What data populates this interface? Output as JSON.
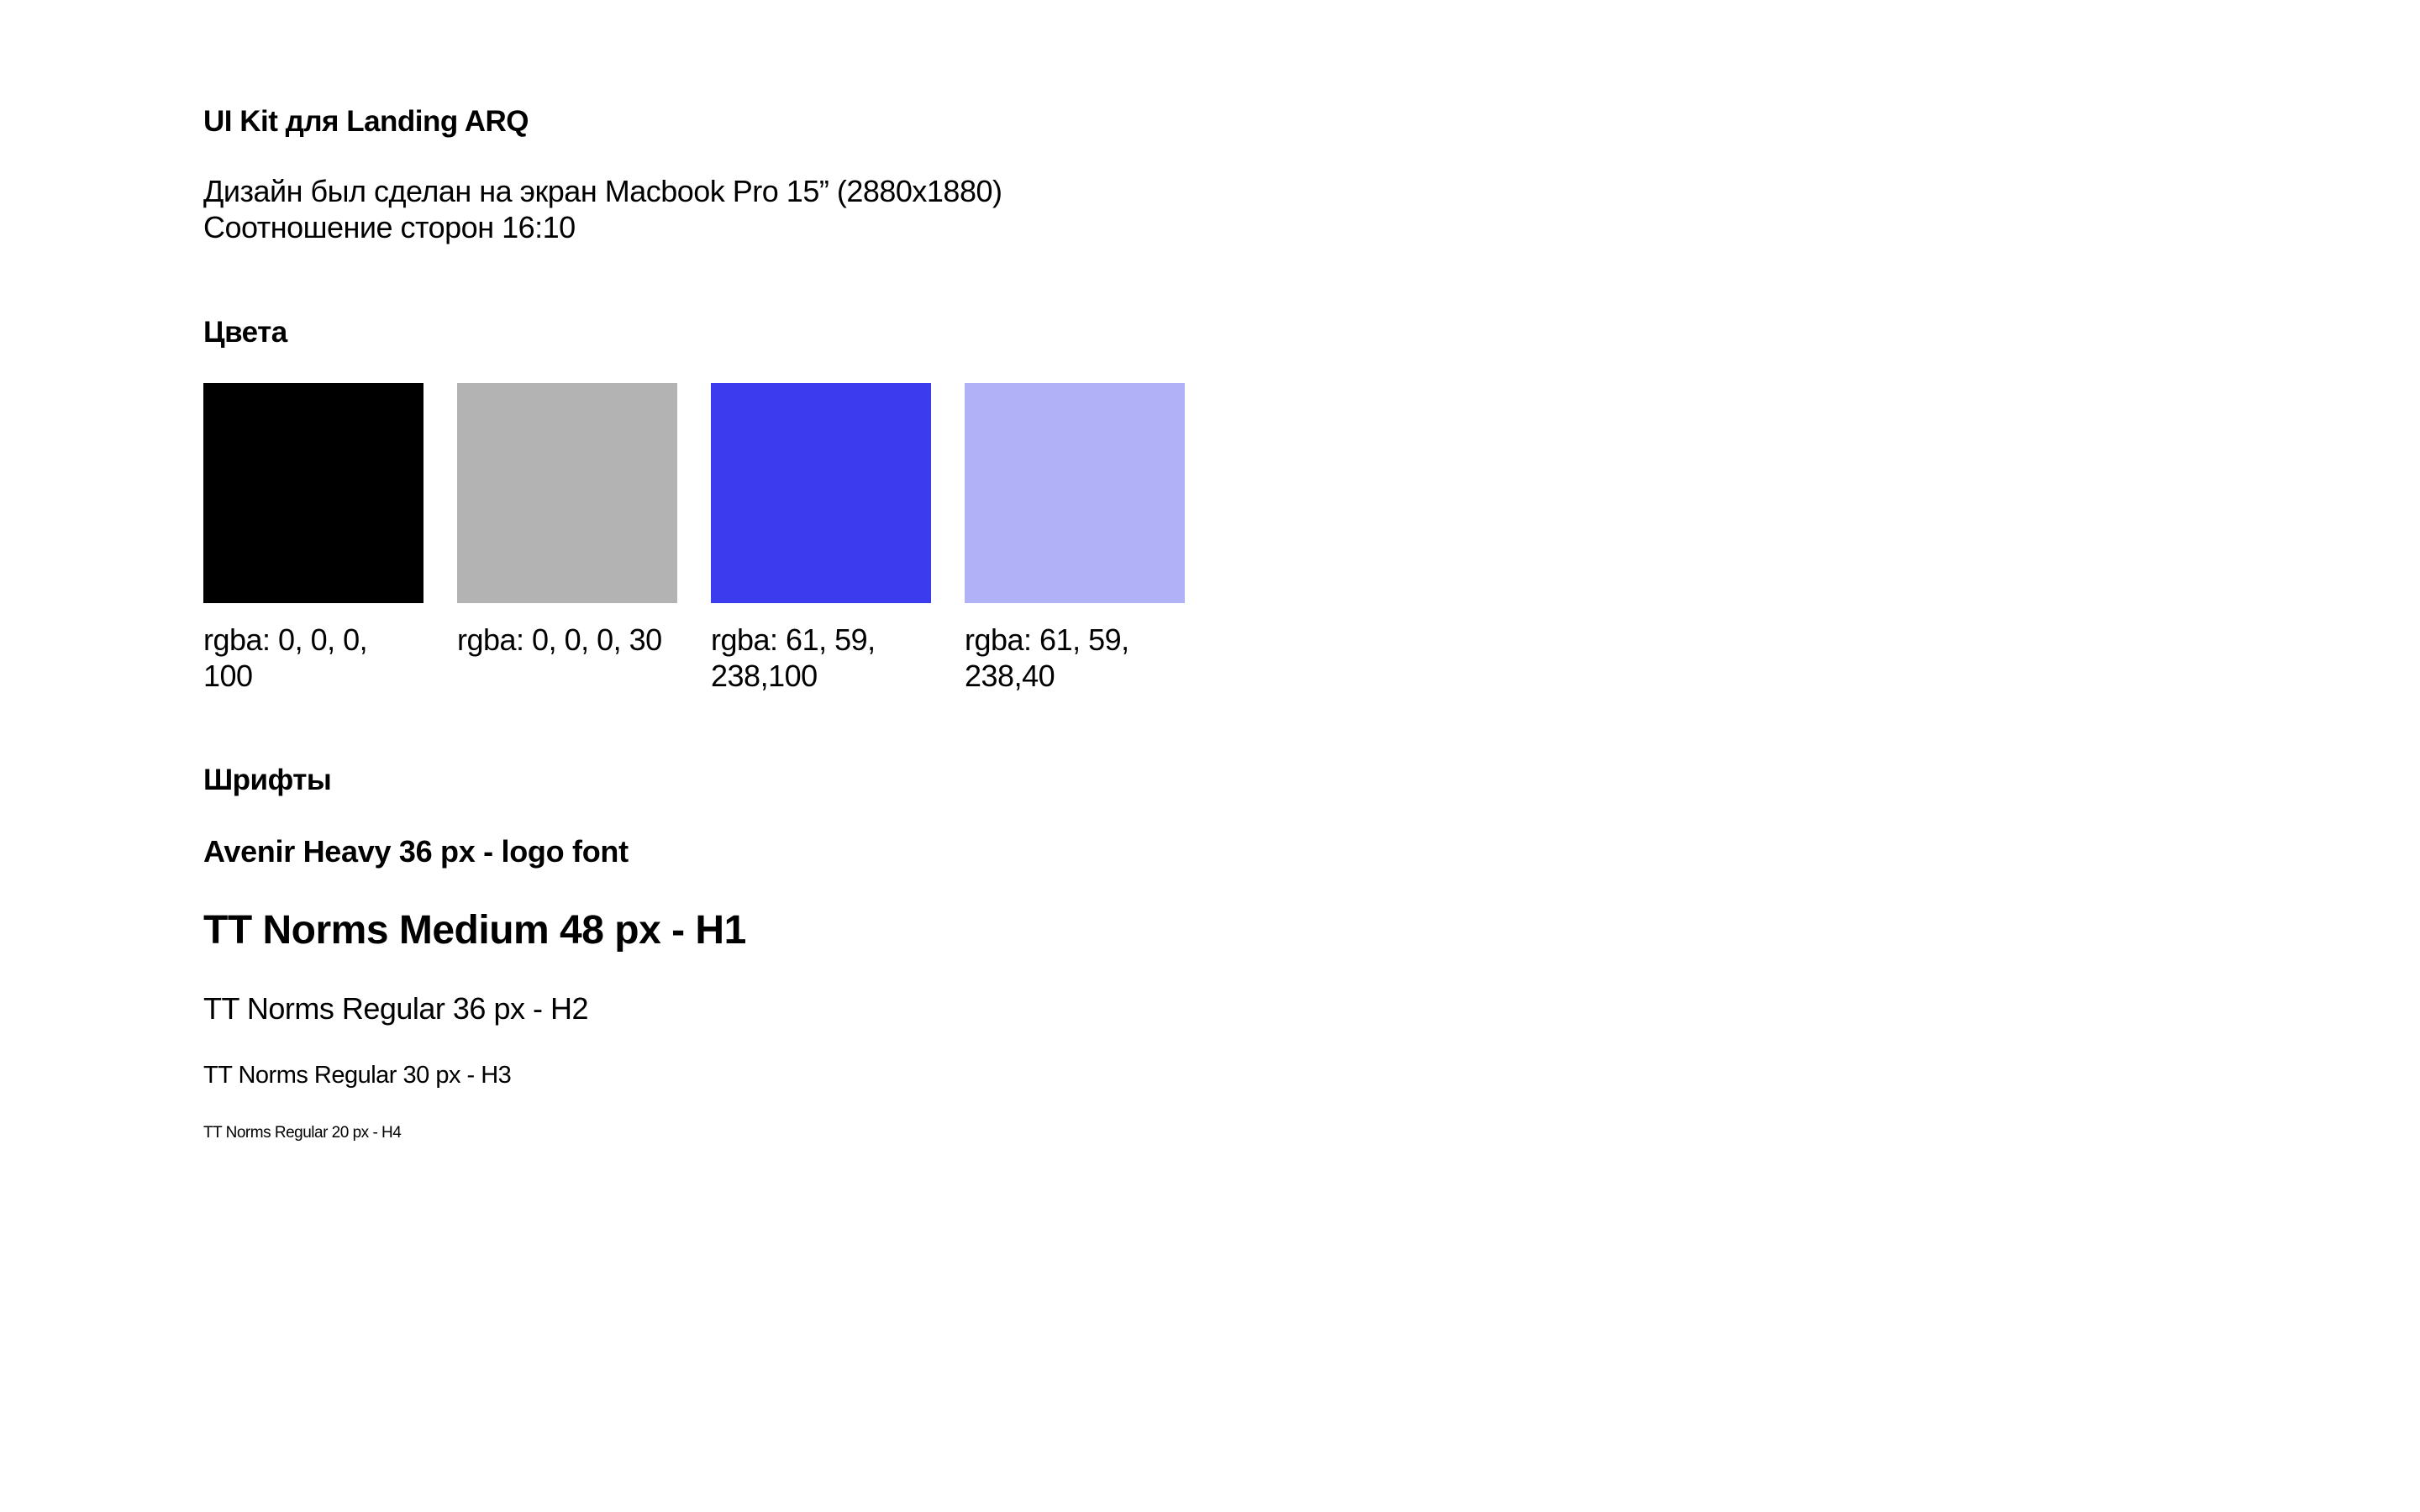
{
  "header": {
    "title": "UI Kit для Landing ARQ",
    "description_line1": "Дизайн был сделан на экран  Macbook Pro 15” (2880x1880)",
    "description_line2": "Соотношение сторон 16:10"
  },
  "colors": {
    "heading": "Цвета",
    "swatches": [
      {
        "caption": "rgba: 0, 0, 0, 100",
        "hex": "#000000"
      },
      {
        "caption": "rgba: 0, 0, 0, 30",
        "hex": "#b3b3b3"
      },
      {
        "caption": "rgba: 61, 59, 238,100",
        "hex": "#3d3bee"
      },
      {
        "caption": "rgba: 61, 59, 238,40",
        "hex": "#b1b1f8"
      }
    ]
  },
  "fonts": {
    "heading": "Шрифты",
    "samples": [
      "Avenir Heavy 36 px - logo font",
      "TT Norms Medium 48 px - H1",
      "TT Norms Regular 36 px - H2",
      "TT Norms Regular 30 px - H3",
      "TT Norms Regular 20 px - H4"
    ]
  }
}
